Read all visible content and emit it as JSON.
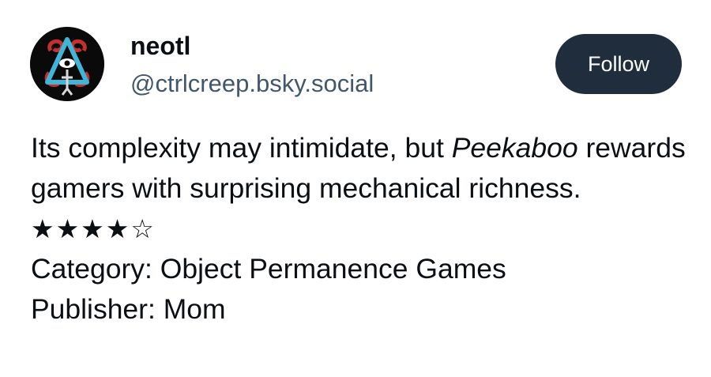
{
  "author": {
    "display_name": "neotl",
    "handle": "@ctrlcreep.bsky.social"
  },
  "follow_button": {
    "label": "Follow"
  },
  "post": {
    "text_before": "Its complexity may intimidate, but ",
    "title_italic": "Peekaboo",
    "text_after": " rewards gamers with surprising mechanical richness.",
    "rating_stars": "★★★★☆",
    "category_line": "Category: Object Permanence Games",
    "publisher_line": "Publisher: Mom"
  },
  "colors": {
    "button_bg": "#1f2d3d",
    "handle_text": "#42576c",
    "body_text": "#0b0f14",
    "avatar_bg": "#0a0a0a",
    "avatar_red": "#c4302b",
    "avatar_blue": "#3fb6d8"
  },
  "icons": {
    "avatar": "eye-triangle-emblem"
  }
}
